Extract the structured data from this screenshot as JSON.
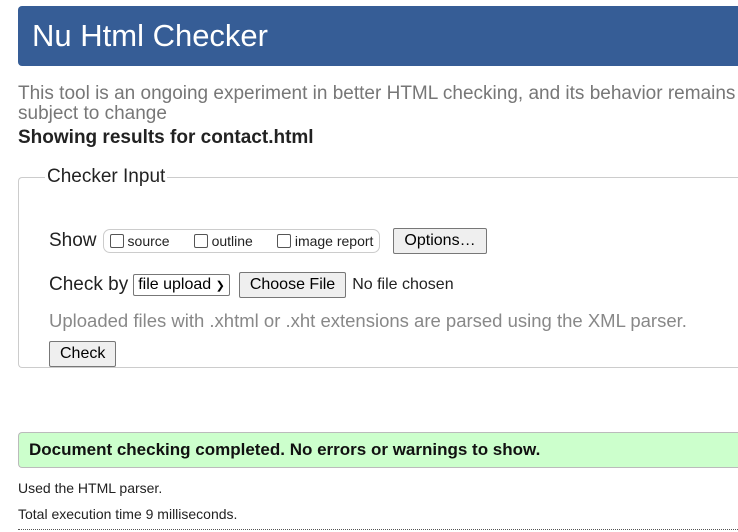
{
  "header": {
    "title": "Nu Html Checker"
  },
  "intro": "This tool is an ongoing experiment in better HTML checking, and its behavior remains subject to change",
  "showing": "Showing results for contact.html",
  "checker_input": {
    "legend": "Checker Input",
    "show_label": "Show",
    "show_options": [
      "source",
      "outline",
      "image report"
    ],
    "options_button": "Options…",
    "check_by_label": "Check by",
    "check_by_value": "file upload",
    "choose_file": "Choose File",
    "no_file": "No file chosen",
    "hint": "Uploaded files with .xhtml or .xht extensions are parsed using the XML parser.",
    "check_button": "Check"
  },
  "result": {
    "message": "Document checking completed. No errors or warnings to show.",
    "parser": "Used the HTML parser.",
    "time": "Total execution time 9 milliseconds."
  }
}
